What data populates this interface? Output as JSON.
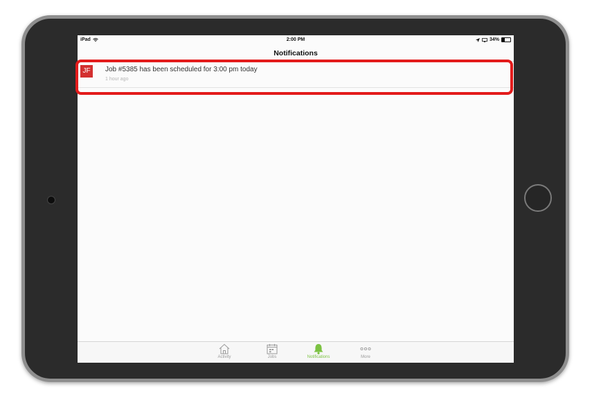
{
  "status_bar": {
    "device": "iPad",
    "time": "2:00 PM",
    "battery_percent_label": "34%",
    "battery_level": 0.34
  },
  "header": {
    "title": "Notifications"
  },
  "notifications": [
    {
      "avatar_initials": "JF",
      "message": "Job #5385 has been scheduled for 3:00 pm today",
      "time_ago": "1 hour ago"
    }
  ],
  "tab_bar": {
    "tabs": [
      {
        "label": "Activity",
        "icon": "home-icon",
        "active": false
      },
      {
        "label": "Jobs",
        "icon": "calendar-icon",
        "active": false
      },
      {
        "label": "Notifications",
        "icon": "bell-icon",
        "active": true
      },
      {
        "label": "More",
        "icon": "more-dots-icon",
        "active": false
      }
    ]
  },
  "colors": {
    "active_tab": "#7cc242",
    "avatar_bg": "#d32f2f",
    "highlight": "#e31b1b"
  }
}
